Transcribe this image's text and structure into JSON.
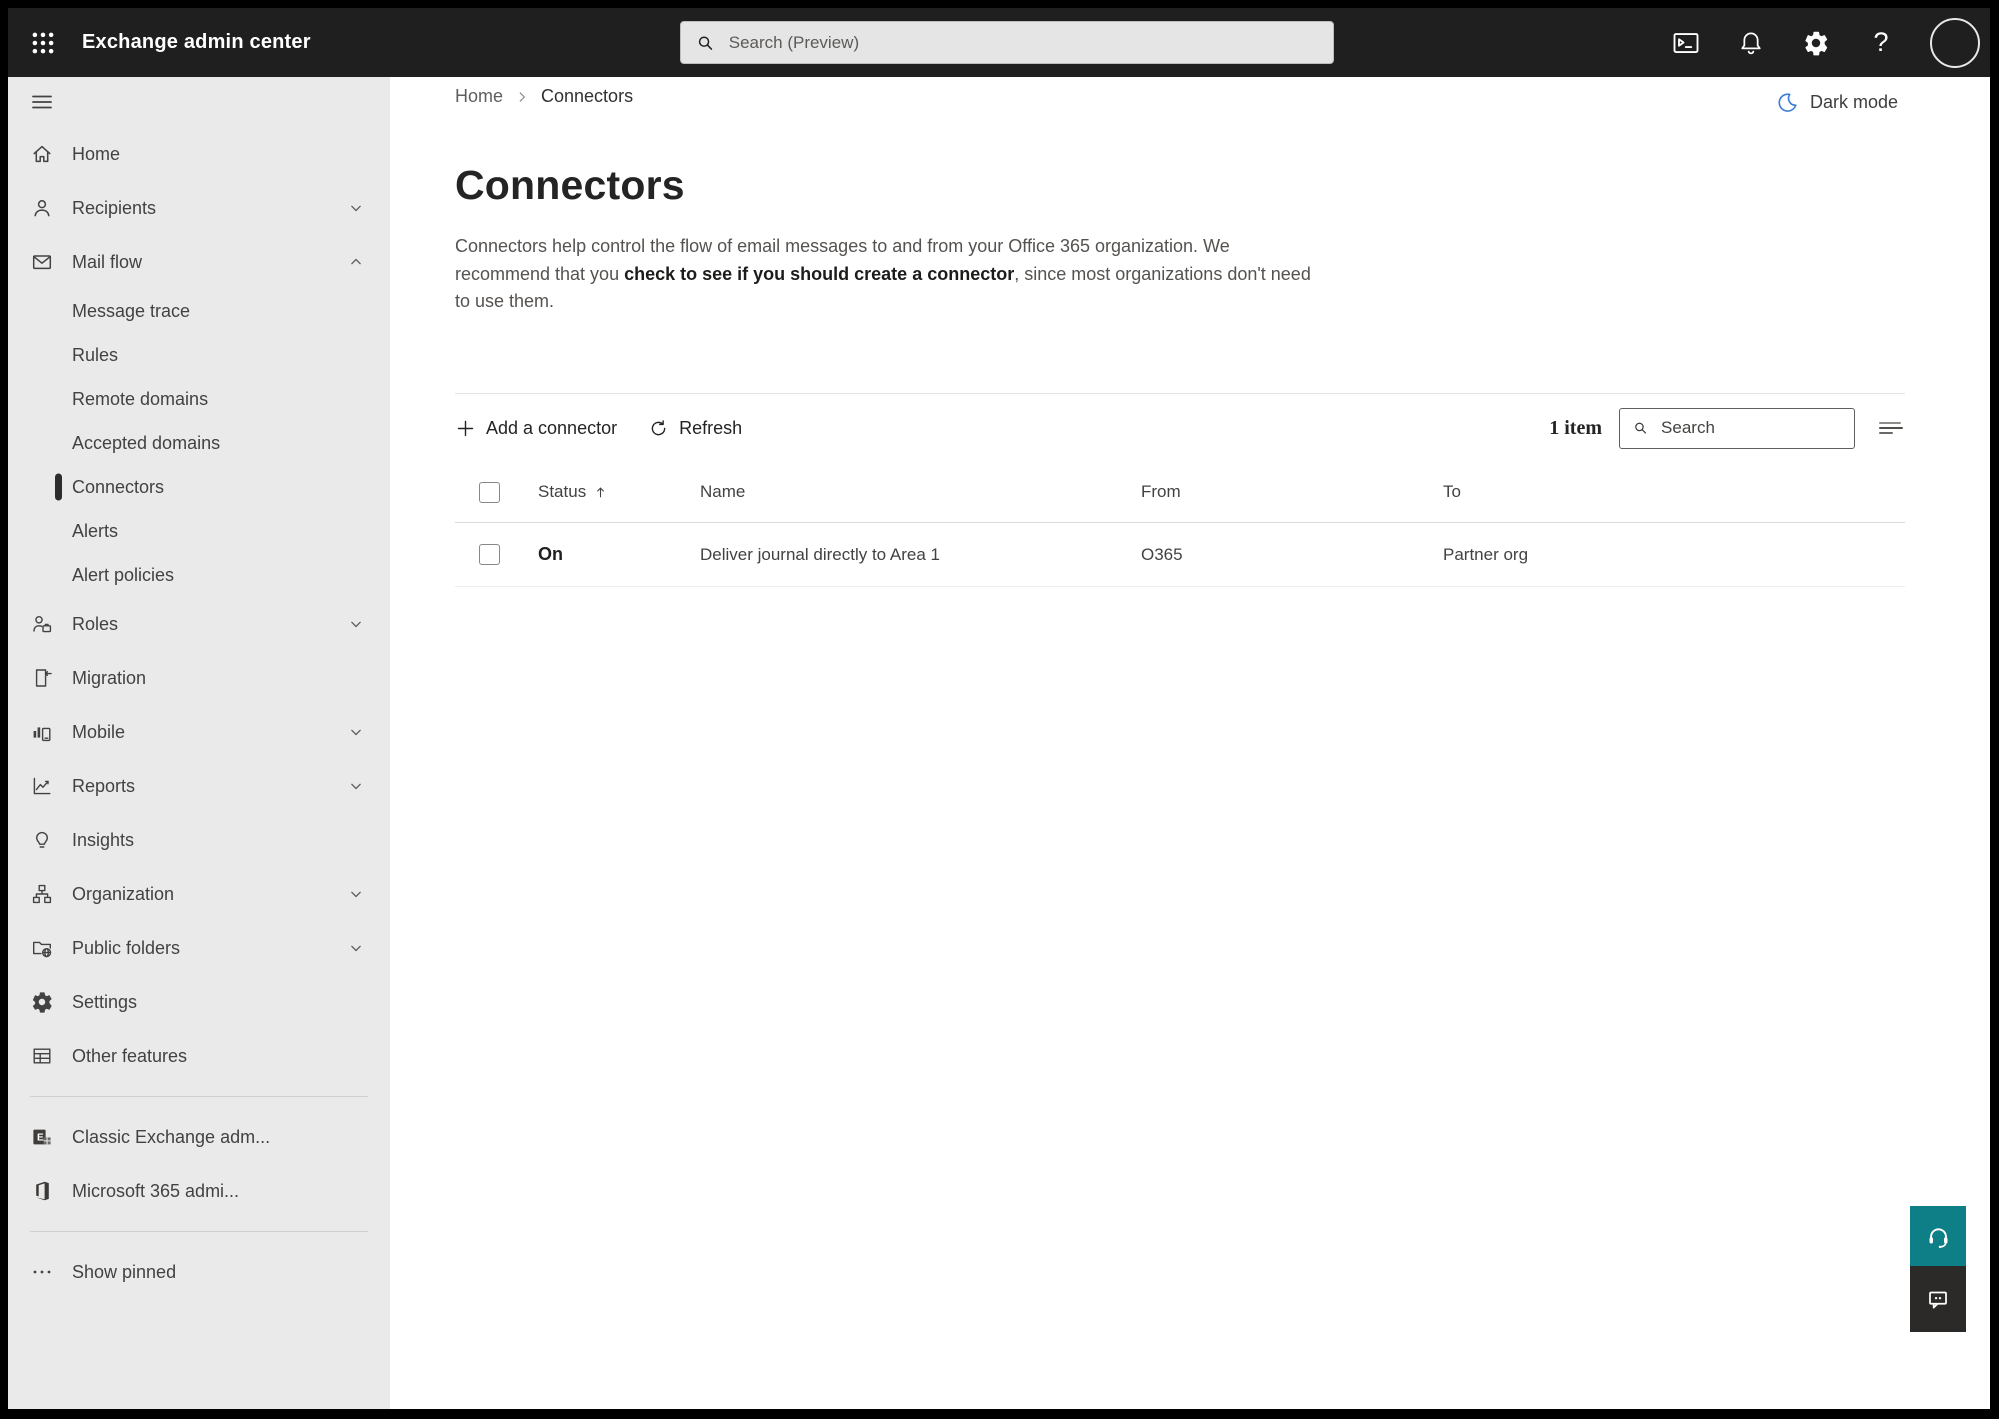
{
  "colors": {
    "accent_blue": "#3b7dd8",
    "teal": "#0e7e87"
  },
  "topbar": {
    "app_title": "Exchange admin center",
    "search_placeholder": "Search (Preview)"
  },
  "sidebar": {
    "items": [
      {
        "label": "Home"
      },
      {
        "label": "Recipients"
      },
      {
        "label": "Mail flow"
      },
      {
        "label": "Message trace"
      },
      {
        "label": "Rules"
      },
      {
        "label": "Remote domains"
      },
      {
        "label": "Accepted domains"
      },
      {
        "label": "Connectors"
      },
      {
        "label": "Alerts"
      },
      {
        "label": "Alert policies"
      },
      {
        "label": "Roles"
      },
      {
        "label": "Migration"
      },
      {
        "label": "Mobile"
      },
      {
        "label": "Reports"
      },
      {
        "label": "Insights"
      },
      {
        "label": "Organization"
      },
      {
        "label": "Public folders"
      },
      {
        "label": "Settings"
      },
      {
        "label": "Other features"
      },
      {
        "label": "Classic Exchange adm..."
      },
      {
        "label": "Microsoft 365 admi..."
      },
      {
        "label": "Show pinned"
      }
    ]
  },
  "breadcrumb": {
    "home": "Home",
    "current": "Connectors"
  },
  "header": {
    "dark_mode_label": "Dark mode"
  },
  "page": {
    "title": "Connectors",
    "description_before": "Connectors help control the flow of email messages to and from your Office 365 organization. We recommend that you ",
    "description_emphasis": "check to see if you should create a connector",
    "description_after": ", since most organizations don't need to use them."
  },
  "toolbar": {
    "add_label": "Add a connector",
    "refresh_label": "Refresh",
    "item_count": "1 item",
    "search_placeholder": "Search"
  },
  "table": {
    "columns": {
      "status": "Status",
      "name": "Name",
      "from": "From",
      "to": "To"
    },
    "rows": [
      {
        "status": "On",
        "name": "Deliver journal directly to Area 1",
        "from": "O365",
        "to": "Partner org"
      }
    ]
  }
}
